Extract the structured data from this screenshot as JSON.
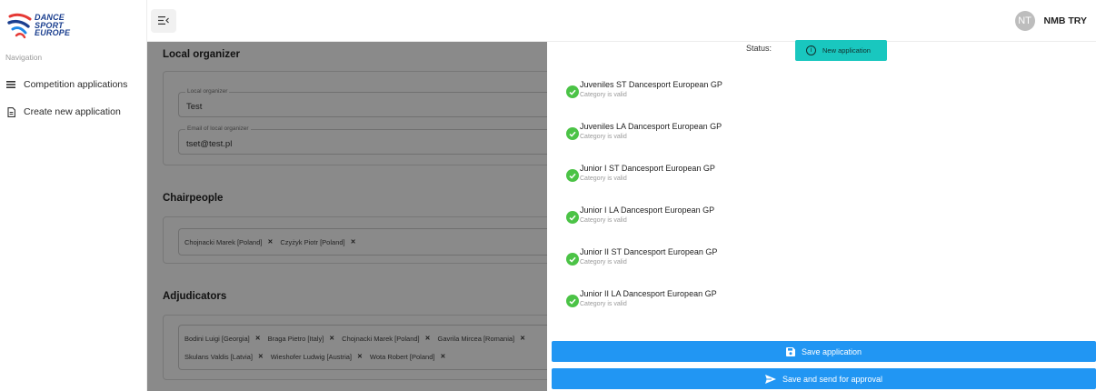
{
  "sidebar": {
    "logo_lines": [
      "DANCE",
      "SPORT",
      "EUROPE"
    ],
    "nav_heading": "Navigation",
    "items": [
      {
        "label": "Competition applications",
        "icon": "list-icon"
      },
      {
        "label": "Create new application",
        "icon": "document-icon"
      }
    ]
  },
  "header": {
    "avatar_initials": "NT",
    "user_name": "NMB TRY"
  },
  "form": {
    "local_organizer": {
      "title": "Local organizer",
      "organizer_label": "Local organizer",
      "organizer_value": "Test",
      "email_label": "Email of local organizer",
      "email_value": "tset@test.pl"
    },
    "chairpeople": {
      "title": "Chairpeople",
      "chips": [
        "Chojnacki Marek [Poland]",
        "Czyżyk Piotr [Poland]"
      ]
    },
    "adjudicators": {
      "title": "Adjudicators",
      "chips": [
        "Bodini Luigi [Georgia]",
        "Braga Pietro [Italy]",
        "Chojnacki Marek [Poland]",
        "Gavrila Mircea [Romania]",
        "Skulans Valdis [Latvia]",
        "Wieshofer Ludwig [Austria]",
        "Wota Robert [Poland]"
      ]
    }
  },
  "panel": {
    "status_label": "Status:",
    "status_value": "New application",
    "categories": [
      {
        "name": "Juveniles ST Dancesport European GP",
        "status": "Category is valid"
      },
      {
        "name": "Juveniles LA Dancesport European GP",
        "status": "Category is valid"
      },
      {
        "name": "Junior I ST Dancesport European GP",
        "status": "Category is valid"
      },
      {
        "name": "Junior I LA Dancesport European GP",
        "status": "Category is valid"
      },
      {
        "name": "Junior II ST Dancesport European GP",
        "status": "Category is valid"
      },
      {
        "name": "Junior II LA Dancesport European GP",
        "status": "Category is valid"
      }
    ],
    "save_label": "Save application",
    "send_label": "Save and send for approval"
  },
  "colors": {
    "primary_button": "#2196f3",
    "status_badge": "#19c7bf",
    "valid_check": "#4bc346",
    "logo_blue": "#1b3f8f",
    "logo_red": "#e53935"
  }
}
